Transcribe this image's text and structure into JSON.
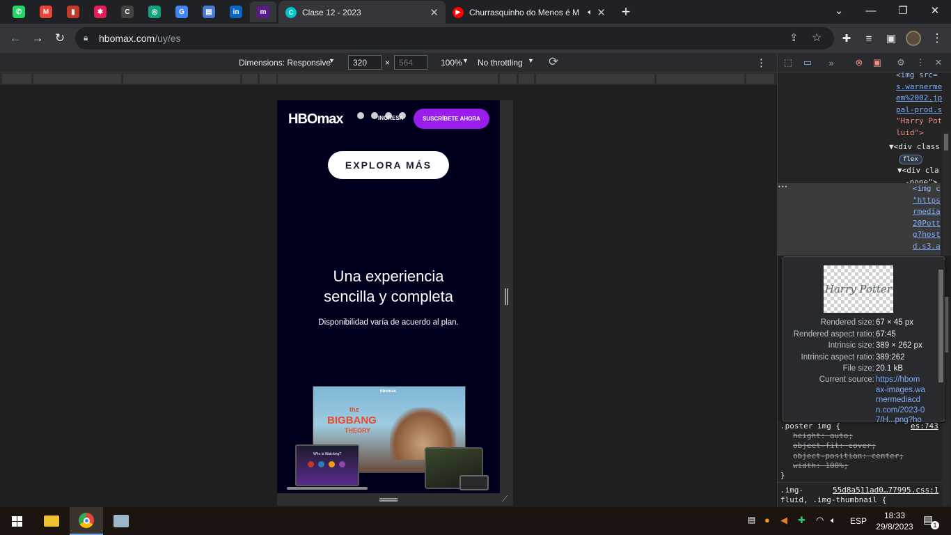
{
  "browser": {
    "pinned_tabs": [
      {
        "name": "whatsapp-tab",
        "icon": "whatsapp-icon",
        "color": "#25d366",
        "glyph": "✆"
      },
      {
        "name": "gmail-tab",
        "icon": "gmail-icon",
        "color": "#ea4335",
        "glyph": "M"
      },
      {
        "name": "bookmark-app-tab",
        "icon": "book-icon",
        "color": "#c0392b",
        "glyph": "▮"
      },
      {
        "name": "slack-tab",
        "icon": "slack-icon",
        "color": "#e01e5a",
        "glyph": "✱"
      },
      {
        "name": "coder-tab",
        "icon": "coder-icon",
        "color": "#444444",
        "glyph": "C"
      },
      {
        "name": "chatgpt-tab",
        "icon": "chatgpt-icon",
        "color": "#10a37f",
        "glyph": "◎"
      },
      {
        "name": "google-tab",
        "icon": "google-icon",
        "color": "#4285f4",
        "glyph": "G"
      },
      {
        "name": "docs-tab",
        "icon": "docs-icon",
        "color": "#4a7bd0",
        "glyph": "▤"
      },
      {
        "name": "linkedin-tab",
        "icon": "linkedin-icon",
        "color": "#0a66c2",
        "glyph": "in"
      },
      {
        "name": "hbomax-tab",
        "icon": "hbomax-icon",
        "color": "#5b1a8a",
        "glyph": "m"
      }
    ],
    "tabs": [
      {
        "title": "Clase 12 - 2023",
        "icon": "canva-icon",
        "color": "#00c4cc",
        "glyph": "C",
        "active": true
      },
      {
        "title": "Churrasquinho do Menos é M",
        "icon": "youtube-icon",
        "color": "#ff0000",
        "glyph": "▶",
        "active": false
      }
    ],
    "new_tab_label": "+",
    "url_host": "hbomax.com",
    "url_path": "/uy/es"
  },
  "devbar": {
    "dimensions_label": "Dimensions: Responsive",
    "width_value": "320",
    "times": "×",
    "height_placeholder": "564",
    "zoom": "100%",
    "throttling": "No throttling"
  },
  "page": {
    "logo_text": "HBOmax",
    "login_label": "INGRESA",
    "subscribe_label": "SUSCRÍBETE AHORA",
    "explore_label": "EXPLORA MÁS",
    "headline_1": "Una experiencia",
    "headline_2": "sencilla y completa",
    "subtitle": "Disponibilidad varía de acuerdo al plan.",
    "promo_show_line1": "the",
    "promo_show_line2": "BIGBANG",
    "promo_show_line3": "THEORY",
    "promo_brand": "hbomax",
    "laptop_prompt": "Who is Watching?"
  },
  "devtools": {
    "elements_lines": [
      {
        "t": "<img src=",
        "c": "tag"
      },
      {
        "t": "s.warnerme",
        "c": "lnk"
      },
      {
        "t": "em%2002.jp",
        "c": "lnk"
      },
      {
        "t": "pal-prod.s",
        "c": "lnk"
      },
      {
        "t": "\"Harry Pot",
        "c": "str"
      },
      {
        "t": "luid\">",
        "c": "str"
      }
    ],
    "div_line_1": "▼<div class",
    "flex_badge": "flex",
    "div_line_2": "▼<div cla",
    "div_line_3": "-none\">",
    "selected_lines": [
      {
        "t": "<img c",
        "c": "tag"
      },
      {
        "t": "\"https",
        "c": "lnk"
      },
      {
        "t": "rmedia",
        "c": "lnk"
      },
      {
        "t": "20Pott",
        "c": "lnk"
      },
      {
        "t": "g?host",
        "c": "lnk"
      },
      {
        "t": "d.s3.a",
        "c": "lnk"
      }
    ],
    "ellipsis": "•••",
    "tooltip": {
      "preview_text": "Harry Potter",
      "rows": [
        {
          "k": "Rendered size:",
          "v": "67 × 45 px"
        },
        {
          "k": "Rendered aspect ratio:",
          "v": "67:45"
        },
        {
          "k": "Intrinsic size:",
          "v": "389 × 262 px"
        },
        {
          "k": "Intrinsic aspect ratio:",
          "v": "389:262"
        },
        {
          "k": "File size:",
          "v": "20.1 kB"
        }
      ],
      "source_label": "Current source:",
      "source_lines": [
        "https://hbom",
        "ax-images.wa",
        "rnermediacd",
        "n.com/2023-0",
        "7/H...png?ho"
      ]
    },
    "css_selector": ".poster img {",
    "css_source": "es:743",
    "css_props": [
      "height: auto;",
      "object-fit: cover;",
      "object-position: center;",
      "width: 100%;"
    ],
    "css_close": "}",
    "css2_selector": ".img-",
    "css2_source": "55d8a511ad0…77995.css:1",
    "css2_line2": "fluid, .img-thumbnail {"
  },
  "taskbar": {
    "lang": "ESP",
    "time": "18:33",
    "date": "29/8/2023",
    "notif_count": "1"
  }
}
